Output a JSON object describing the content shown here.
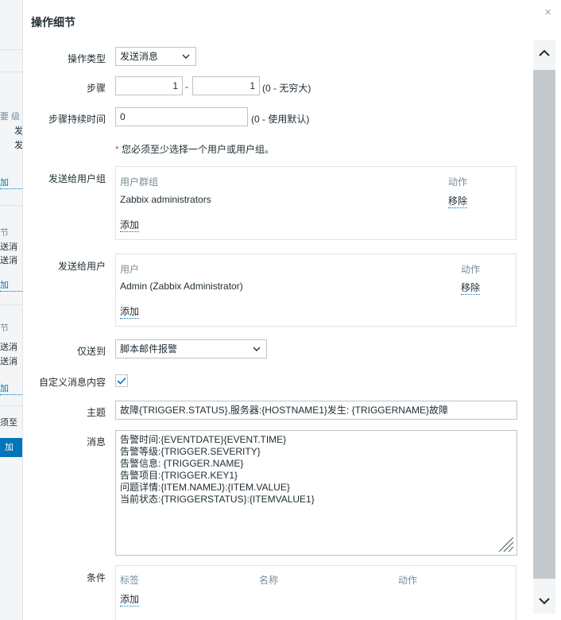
{
  "background": {
    "fragments": [
      "要 级",
      "发",
      "发",
      "加",
      "节",
      "送消",
      "送消",
      "加",
      "节",
      "送消",
      "送消",
      "加",
      "须至"
    ],
    "button_label": "加"
  },
  "dialog": {
    "title": "操作细节",
    "close_glyph": "×"
  },
  "form": {
    "operation_type": {
      "label": "操作类型",
      "value": "发送消息"
    },
    "steps": {
      "label": "步骤",
      "from": "1",
      "separator": "-",
      "to": "1",
      "hint": "(0 - 无穷大)"
    },
    "step_duration": {
      "label": "步骤持续时间",
      "value": "0",
      "hint": "(0 - 使用默认)"
    },
    "warning": {
      "star": "*",
      "text": "您必须至少选择一个用户或用户组。"
    },
    "send_to_groups": {
      "label": "发送给用户组",
      "col_name": "用户群组",
      "col_action": "动作",
      "rows": [
        {
          "name": "Zabbix administrators",
          "action": "移除"
        }
      ],
      "add_label": "添加"
    },
    "send_to_users": {
      "label": "发送给用户",
      "col_name": "用户",
      "col_action": "动作",
      "rows": [
        {
          "name": "Admin (Zabbix Administrator)",
          "action": "移除"
        }
      ],
      "add_label": "添加"
    },
    "send_only_to": {
      "label": "仅送到",
      "value": "脚本邮件报警"
    },
    "custom_message": {
      "label": "自定义消息内容",
      "checked": true
    },
    "subject": {
      "label": "主题",
      "value": "故障{TRIGGER.STATUS},服务器:{HOSTNAME1}发生: {TRIGGERNAME}故障"
    },
    "message": {
      "label": "消息",
      "lines": [
        "告警时间:{EVENTDATE}{EVENT.TIME}",
        "告警等级:{TRIGGER.SEVERITY}",
        "告警信息: {TRIGGER.NAME}",
        "告警项目:{TRIGGER.KEY1}",
        "问题详情:{ITEM.NAMEJ}:{ITEM.VALUE}",
        "当前状态:{TRIGGERSTATUS}:{ITEMVALUE1}"
      ]
    },
    "conditions": {
      "label": "条件",
      "col_label": "标签",
      "col_name": "名称",
      "col_action": "动作",
      "add_label": "添加"
    }
  },
  "colors": {
    "accent": "#0275b8",
    "required": "#d64e4e",
    "checkbox_check": "#0275b8"
  },
  "icons": {
    "close": "close-icon",
    "scroll_up": "chevron-up-icon",
    "scroll_down": "chevron-down-icon",
    "select_arrow": "chevron-down-icon",
    "checkmark": "check-icon",
    "resize": "resize-grip-icon"
  }
}
